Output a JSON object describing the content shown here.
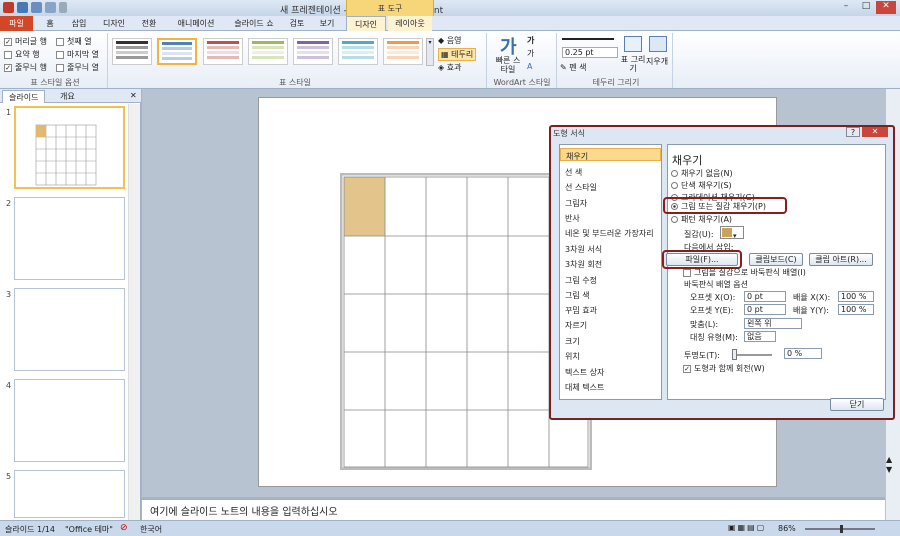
{
  "window": {
    "title": "새 프레젠테이션 - Microsoft PowerPoint",
    "tool_tab": "표 도구",
    "min": "–",
    "max": "□",
    "close": "✕"
  },
  "tabs": [
    "파일",
    "홈",
    "삽입",
    "디자인",
    "전환",
    "애니메이션",
    "슬라이드 쇼",
    "검토",
    "보기",
    "디자인",
    "레이아웃"
  ],
  "ribbon": {
    "style_options": {
      "items": [
        {
          "label": "머리글 행",
          "checked": true
        },
        {
          "label": "첫째 열",
          "checked": false
        },
        {
          "label": "요약 행",
          "checked": false
        },
        {
          "label": "마지막 열",
          "checked": false
        },
        {
          "label": "줄무늬 행",
          "checked": true
        },
        {
          "label": "줄무늬 열",
          "checked": false
        }
      ],
      "group_label": "표 스타일 옵션"
    },
    "table_styles": {
      "group_label": "표 스타일",
      "shading": "음영",
      "borders": "테두리",
      "effects": "효과"
    },
    "wordart": {
      "quick_styles": "빠른 스타일",
      "group_label": "WordArt 스타일",
      "text_fill": "가",
      "text_outline": "가",
      "text_effects": "A"
    },
    "draw_borders": {
      "pen_weight": "0.25 pt",
      "pen_color": "펜 색",
      "draw_table": "표 그리기",
      "eraser": "지우개",
      "group_label": "테두리 그리기"
    }
  },
  "left_pane": {
    "tabs": [
      "슬라이드",
      "개요"
    ],
    "close": "✕",
    "slide_numbers": [
      "1",
      "2",
      "3",
      "4",
      "5"
    ]
  },
  "notes_placeholder": "여기에 슬라이드 노트의 내용을 입력하십시오",
  "status": {
    "slide": "슬라이드 1/14",
    "theme": "\"Office 테마\"",
    "language": "한국어",
    "zoom": "86%"
  },
  "dialog": {
    "title": "도형 서식",
    "categories": [
      "채우기",
      "선 색",
      "선 스타일",
      "그림자",
      "반사",
      "네온 및 부드러운 가장자리",
      "3차원 서식",
      "3차원 회전",
      "그림 수정",
      "그림 색",
      "꾸밈 효과",
      "자르기",
      "크기",
      "위치",
      "텍스트 상자",
      "대체 텍스트"
    ],
    "heading": "채우기",
    "fill_options": [
      {
        "label": "채우기 없음(N)",
        "selected": false
      },
      {
        "label": "단색 채우기(S)",
        "selected": false
      },
      {
        "label": "그라데이션 채우기(G)",
        "selected": false
      },
      {
        "label": "그림 또는 질감 채우기(P)",
        "selected": true
      },
      {
        "label": "패턴 채우기(A)",
        "selected": false
      }
    ],
    "texture_label": "질감(U):",
    "insert_from": "다음에서 삽입:",
    "file_button": "파일(F)...",
    "clipboard_button": "클립보드(C)",
    "clipart_button": "클립 아트(R)...",
    "tile_checkbox": "그림을 질감으로 바둑판식 배열(I)",
    "tile_options_label": "바둑판식 배열 옵션",
    "offset_x_label": "오프셋 X(O):",
    "offset_x": "0 pt",
    "scale_x_label": "배율 X(X):",
    "scale_x": "100 %",
    "offset_y_label": "오프셋 Y(E):",
    "offset_y": "0 pt",
    "scale_y_label": "배율 Y(Y):",
    "scale_y": "100 %",
    "align_label": "맞춤(L):",
    "align": "왼쪽 위",
    "mirror_label": "대칭 유형(M):",
    "mirror": "없음",
    "transparency_label": "투명도(T):",
    "transparency": "0 %",
    "rotate_checkbox": "도형과 함께 회전(W)",
    "close_button": "닫기"
  }
}
